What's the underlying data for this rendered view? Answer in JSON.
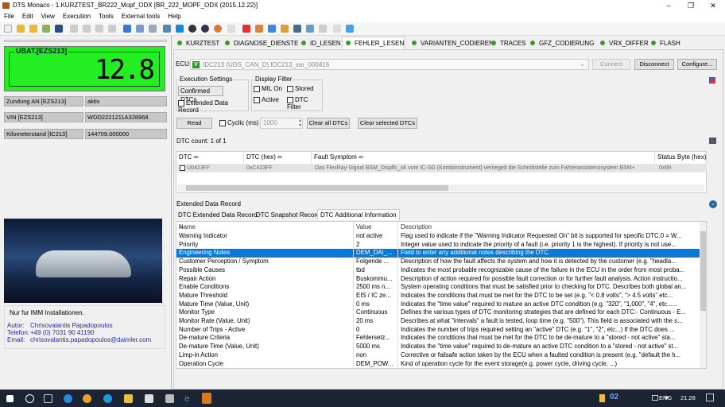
{
  "window": {
    "title": "DTS Monaco - 1.KURZTEST_BR222_Mopf_ODX [BR_222_MOPF_ODX (2015.12.22)]",
    "min": "–",
    "max": "❐",
    "close": "✕"
  },
  "menu": [
    "File",
    "Edit",
    "View",
    "Execution",
    "Tools",
    "External tools",
    "Help"
  ],
  "left": {
    "ubat_label": "UBAT.[EZS213]",
    "ubat_value": "12.8",
    "fields": [
      {
        "k": "Zundung AN [EZS213]",
        "v": "aktiv"
      },
      {
        "k": "VIN [EZS213]",
        "v": "WDD2221211A328968"
      },
      {
        "k": "Kilometerstand [IC213]",
        "v": "144709.000000"
      }
    ],
    "note": "Nur fur IMM Installationen.",
    "author_label": "Autor:",
    "author": "Chrisovalantis Papadopoulos",
    "phone_label": "Telefon:",
    "phone": "+49 (0) 7031 90 41190",
    "email_label": "Email:",
    "email": "chrisovalantis.papadopoulos@daimler.com"
  },
  "tabs": [
    "KURZTEST",
    "DIAGNOSE_DIENSTE",
    "ID_LESEN",
    "FEHLER_LESEN",
    "VARIANTEN_CODIEREN",
    "TRACES",
    "GFZ_CODIERUNG",
    "VRX_DIFFER",
    "FLASH"
  ],
  "ecu": {
    "label": "ECU:",
    "badge": "V",
    "value": "IDC213 (UDS_CAN_D).IDC213_var_000416",
    "connect": "Connect",
    "disconnect": "Disconnect",
    "configure": "Configure..."
  },
  "exec": {
    "title": "Execution Settings",
    "select": "Confirmed DTCs",
    "extended": "Extended Data Record"
  },
  "filter": {
    "title": "Display Filter",
    "mil": "MIL On",
    "stored": "Stored",
    "active": "Active",
    "dtcfilter": "DTC Filter"
  },
  "actions": {
    "read": "Read",
    "cyclic": "Cyclic (ms)",
    "cyclic_value": "1000",
    "clear_all": "Clear all DTCs",
    "clear_selected": "Clear selected DTCs"
  },
  "dtc_count": "DTC count:  1 of 1",
  "dtc_grid": {
    "headers": [
      "DTC",
      "DTC (hex)",
      "Fault Symptom",
      "Status Byte (hex)"
    ],
    "rows": [
      {
        "dtc": "U0423FF",
        "hex": "0xC423FF",
        "symptom": "Das FlexRay-Signal BSM_Displfc_ok vom IC-SG (Kombiinstrument) verriegelt die Schnittstelle zum Fahrerassistenzsystem BSM+",
        "status": "0x69"
      }
    ]
  },
  "ext_title": "Extended Data Record",
  "subtabs": [
    "DTC Extended Data Record",
    "DTC Snapshot Record",
    "DTC Additional Information"
  ],
  "info": {
    "headers": [
      "Name",
      "Value",
      "Description"
    ],
    "rows": [
      [
        "Warning Indicator",
        "not active",
        "Flag used to indicate if the \"Warning Indicator Requested On\" bit is supported for specific DTC.0 = W..."
      ],
      [
        "Priority",
        "2",
        "Integer value used to indicate the priority of a fault (i.e. priority 1 is the highest). If priority is not use..."
      ],
      [
        "Engineering Notes",
        "DEM_DAI_...",
        "Field to enter any additional notes describing the DTC."
      ],
      [
        "Customer Perception / Symptom",
        "Folgende ...",
        "Description of how the fault affects the system and how it is detected by the customer (e.g. \"headla..."
      ],
      [
        "Possible Causes",
        "tbd",
        "Indicates the most probable recognizable cause of the failure in the ECU in the order from most proba..."
      ],
      [
        "Repair Action",
        "Buskommu...",
        "Description of action required for possible fault correction or for further fault analysis. Action instructio..."
      ],
      [
        "Enable Conditions",
        "2500 ms n...",
        "System operating conditions that must be satisfied prior to checking for DTC. Describes both global an..."
      ],
      [
        "Mature Threshold",
        "EIS / IC ze...",
        "Indicates the conditions that must be met for the DTC to be set (e.g. \"< 0.8 volts\", \"> 4.5 volts\" etc..."
      ],
      [
        "Mature Time (Value, Unit)",
        "0 ms",
        "Indicates the \"time value\" required to mature an active DTC condition (e.g. \"320\", \"1,000\", \"4\", etc......"
      ],
      [
        "Monitor Type",
        "Continuous",
        "Defines the various types of DTC monitoring strategies that are defined for each DTC:- Continuous - E..."
      ],
      [
        "Monitor Rate (Value, Unit)",
        "20 ms",
        "Describes at what \"intervals\" a fault is tested, loop time (e.g. \"500\"). This field is associated with the s..."
      ],
      [
        "Number of Trips - Active",
        "0",
        "Indicates the number of trips required setting an \"active\" DTC (e.g. \"1\", \"2\", etc...) If the DTC does ..."
      ],
      [
        "De-mature Criteria",
        "Fehlersetz...",
        "Indicates the conditions that must be met for the DTC to be de-mature to a \"stored - not active\" sta..."
      ],
      [
        "De-mature Time (Value, Unit)",
        "5000 ms",
        "Indicates the \"time value\" required to de-mature an active DTC condition to a \"stored - not active\" st..."
      ],
      [
        "Limp-in Action",
        "non",
        "Corrective or failsafe action taken by the ECU when a faulted condition is present (e.g. \"default the h..."
      ],
      [
        "Operation Cycle",
        "DEM_POW...",
        "Kind of operation cycle for the event storage(e.g. power cycle, driving cycle, ...)"
      ]
    ],
    "selected": 2
  },
  "taskbar": {
    "lang": "ENG",
    "time": "21:28",
    "badge": "02"
  },
  "colors": {
    "lcd": "#22ee22",
    "selection": "#0a78d7",
    "tab_dot": "#3c9a2a",
    "taskbar": "#1c2433"
  }
}
